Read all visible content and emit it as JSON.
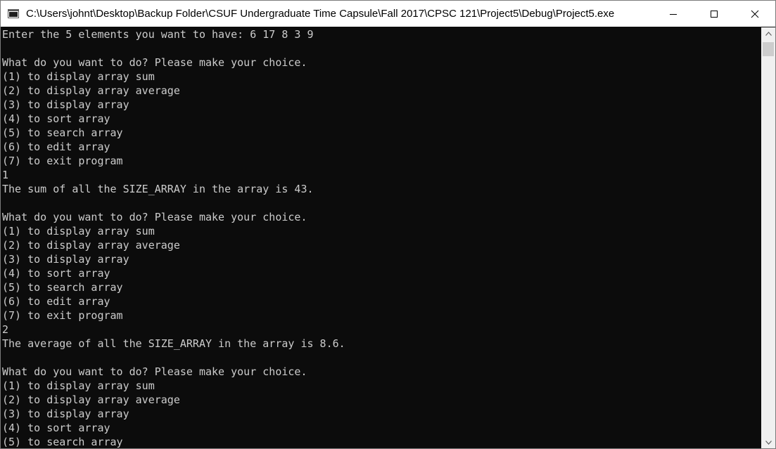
{
  "window": {
    "title": "C:\\Users\\johnt\\Desktop\\Backup Folder\\CSUF Undergraduate Time Capsule\\Fall 2017\\CPSC 121\\Project5\\Debug\\Project5.exe",
    "icon": "console-app-icon",
    "controls": {
      "minimize_icon": "minimize-icon",
      "maximize_icon": "maximize-icon",
      "close_icon": "close-icon"
    }
  },
  "console": {
    "background": "#0c0c0c",
    "text_color": "#cccccc",
    "lines": [
      "Enter the 5 elements you want to have: 6 17 8 3 9",
      "",
      "What do you want to do? Please make your choice.",
      "(1) to display array sum",
      "(2) to display array average",
      "(3) to display array",
      "(4) to sort array",
      "(5) to search array",
      "(6) to edit array",
      "(7) to exit program",
      "1",
      "The sum of all the SIZE_ARRAY in the array is 43.",
      "",
      "What do you want to do? Please make your choice.",
      "(1) to display array sum",
      "(2) to display array average",
      "(3) to display array",
      "(4) to sort array",
      "(5) to search array",
      "(6) to edit array",
      "(7) to exit program",
      "2",
      "The average of all the SIZE_ARRAY in the array is 8.6.",
      "",
      "What do you want to do? Please make your choice.",
      "(1) to display array sum",
      "(2) to display array average",
      "(3) to display array",
      "(4) to sort array",
      "(5) to search array"
    ]
  },
  "scrollbar": {
    "up_icon": "scroll-up-arrow-icon",
    "down_icon": "scroll-down-arrow-icon"
  }
}
